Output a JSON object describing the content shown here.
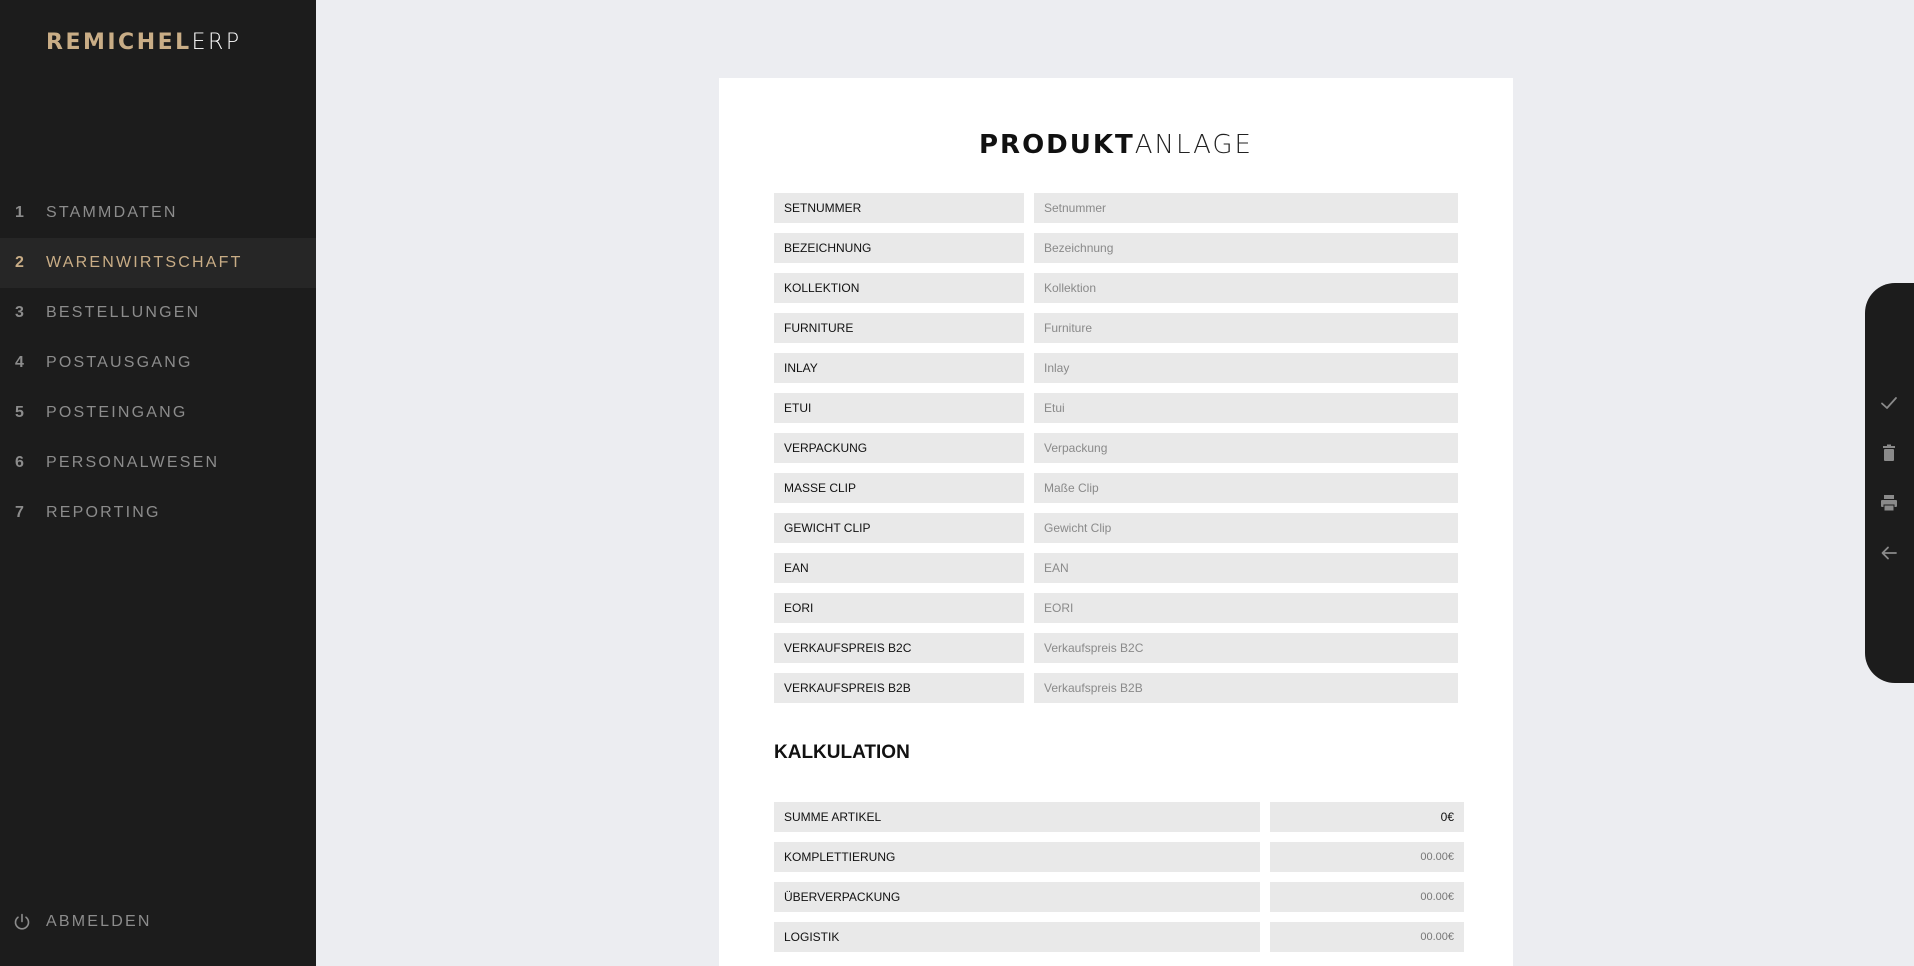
{
  "app": {
    "brand_strong": "REMICHEL",
    "brand_light": "ERP"
  },
  "sidebar": {
    "items": [
      {
        "num": "1",
        "label": "STAMMDATEN",
        "active": false
      },
      {
        "num": "2",
        "label": "WARENWIRTSCHAFT",
        "active": true
      },
      {
        "num": "3",
        "label": "BESTELLUNGEN",
        "active": false
      },
      {
        "num": "4",
        "label": "POSTAUSGANG",
        "active": false
      },
      {
        "num": "5",
        "label": "POSTEINGANG",
        "active": false
      },
      {
        "num": "6",
        "label": "PERSONALWESEN",
        "active": false
      },
      {
        "num": "7",
        "label": "REPORTING",
        "active": false
      }
    ],
    "logout_label": "ABMELDEN",
    "logout_icon": "power-icon"
  },
  "form": {
    "title_bold": "PRODUKT",
    "title_light": "ANLAGE",
    "fields": [
      {
        "label": "SETNUMMER",
        "placeholder": "Setnummer",
        "value": ""
      },
      {
        "label": "BEZEICHNUNG",
        "placeholder": "Bezeichnung",
        "value": ""
      },
      {
        "label": "KOLLEKTION",
        "placeholder": "Kollektion",
        "value": ""
      },
      {
        "label": "FURNITURE",
        "placeholder": "Furniture",
        "value": ""
      },
      {
        "label": "INLAY",
        "placeholder": "Inlay",
        "value": ""
      },
      {
        "label": "ETUI",
        "placeholder": "Etui",
        "value": ""
      },
      {
        "label": "VERPACKUNG",
        "placeholder": "Verpackung",
        "value": ""
      },
      {
        "label": "MASSE CLIP",
        "placeholder": "Maße Clip",
        "value": ""
      },
      {
        "label": "GEWICHT CLIP",
        "placeholder": "Gewicht Clip",
        "value": ""
      },
      {
        "label": "EAN",
        "placeholder": "EAN",
        "value": ""
      },
      {
        "label": "EORI",
        "placeholder": "EORI",
        "value": ""
      },
      {
        "label": "VERKAUFSPREIS B2C",
        "placeholder": "Verkaufspreis B2C",
        "value": ""
      },
      {
        "label": "VERKAUFSPREIS B2B",
        "placeholder": "Verkaufspreis B2B",
        "value": ""
      }
    ]
  },
  "calculation": {
    "title": "KALKULATION",
    "rows": [
      {
        "label": "SUMME ARTIKEL",
        "value": "0€"
      },
      {
        "label": "KOMPLETTIERUNG",
        "value": "00.00€"
      },
      {
        "label": "ÜBERVERPACKUNG",
        "value": "00.00€"
      },
      {
        "label": "LOGISTIK",
        "value": "00.00€"
      }
    ]
  },
  "toolbar": {
    "tools": [
      "check-icon",
      "trash-icon",
      "print-icon",
      "back-arrow-icon"
    ]
  },
  "colors": {
    "sidebar_bg": "#1c1c1c",
    "accent": "#c9ad86",
    "page_bg": "#ecedf1",
    "field_bg": "#e9e9e9"
  }
}
